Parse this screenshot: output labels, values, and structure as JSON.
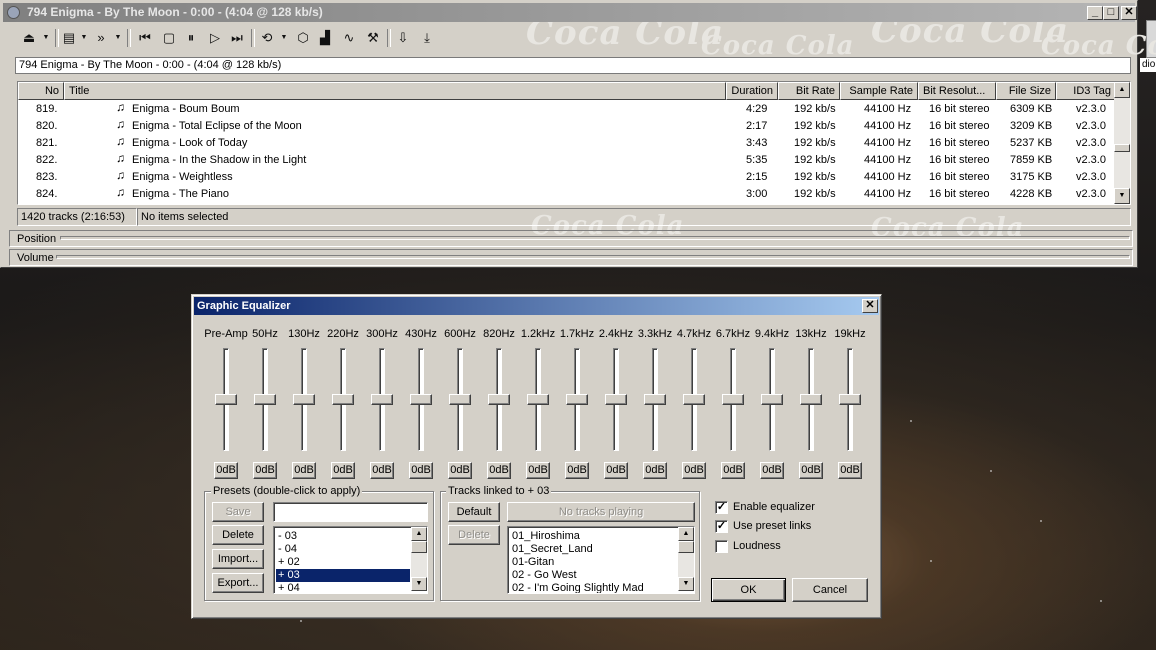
{
  "window": {
    "title": "794 Enigma - By The Moon - 0:00 - (4:04 @ 128 kb/s)",
    "address": "794 Enigma - By The Moon - 0:00 - (4:04 @ 128 kb/s)",
    "watermark": "Coca Cola",
    "caption_buttons": {
      "minimize": "_",
      "maximize": "□",
      "close": "✕"
    }
  },
  "toolbar": {
    "icons": [
      "eject-icon",
      "playlist-icon",
      "tools-icon",
      "previous-icon",
      "stop-icon",
      "play-icon",
      "next-icon",
      "repeat-icon",
      "cube-icon",
      "visualization-icon",
      "waveform-icon",
      "settings-icon",
      "arrow-down-icon",
      "download-icon"
    ]
  },
  "playlist": {
    "columns": [
      "No",
      "Title",
      "Duration",
      "Bit Rate",
      "Sample Rate",
      "Bit Resolut...",
      "File Size",
      "ID3 Tag"
    ],
    "rows": [
      {
        "no": "819.",
        "title": "Enigma - Boum Boum",
        "duration": "4:29",
        "bitrate": "192 kb/s",
        "samplerate": "44100 Hz",
        "resolution": "16 bit stereo",
        "size": "6309 KB",
        "tag": "v2.3.0"
      },
      {
        "no": "820.",
        "title": "Enigma - Total Eclipse of the Moon",
        "duration": "2:17",
        "bitrate": "192 kb/s",
        "samplerate": "44100 Hz",
        "resolution": "16 bit stereo",
        "size": "3209 KB",
        "tag": "v2.3.0"
      },
      {
        "no": "821.",
        "title": "Enigma - Look of Today",
        "duration": "3:43",
        "bitrate": "192 kb/s",
        "samplerate": "44100 Hz",
        "resolution": "16 bit stereo",
        "size": "5237 KB",
        "tag": "v2.3.0"
      },
      {
        "no": "822.",
        "title": "Enigma - In the Shadow in the Light",
        "duration": "5:35",
        "bitrate": "192 kb/s",
        "samplerate": "44100 Hz",
        "resolution": "16 bit stereo",
        "size": "7859 KB",
        "tag": "v2.3.0"
      },
      {
        "no": "823.",
        "title": "Enigma - Weightless",
        "duration": "2:15",
        "bitrate": "192 kb/s",
        "samplerate": "44100 Hz",
        "resolution": "16 bit stereo",
        "size": "3175 KB",
        "tag": "v2.3.0"
      },
      {
        "no": "824.",
        "title": "Enigma - The Piano",
        "duration": "3:00",
        "bitrate": "192 kb/s",
        "samplerate": "44100 Hz",
        "resolution": "16 bit stereo",
        "size": "4228 KB",
        "tag": "v2.3.0"
      }
    ]
  },
  "status": {
    "tracks": "1420 tracks (2:16:53)",
    "selection": "No items selected"
  },
  "position_label": "Position",
  "volume_label": "Volume",
  "equalizer": {
    "title": "Graphic Equalizer",
    "close": "✕",
    "bands": [
      {
        "label": "Pre-Amp",
        "value": "0dB"
      },
      {
        "label": "50Hz",
        "value": "0dB"
      },
      {
        "label": "130Hz",
        "value": "0dB"
      },
      {
        "label": "220Hz",
        "value": "0dB"
      },
      {
        "label": "300Hz",
        "value": "0dB"
      },
      {
        "label": "430Hz",
        "value": "0dB"
      },
      {
        "label": "600Hz",
        "value": "0dB"
      },
      {
        "label": "820Hz",
        "value": "0dB"
      },
      {
        "label": "1.2kHz",
        "value": "0dB"
      },
      {
        "label": "1.7kHz",
        "value": "0dB"
      },
      {
        "label": "2.4kHz",
        "value": "0dB"
      },
      {
        "label": "3.3kHz",
        "value": "0dB"
      },
      {
        "label": "4.7kHz",
        "value": "0dB"
      },
      {
        "label": "6.7kHz",
        "value": "0dB"
      },
      {
        "label": "9.4kHz",
        "value": "0dB"
      },
      {
        "label": "13kHz",
        "value": "0dB"
      },
      {
        "label": "19kHz",
        "value": "0dB"
      }
    ],
    "presets": {
      "group_label": "Presets (double-click to apply)",
      "save": "Save",
      "delete": "Delete",
      "import": "Import...",
      "export": "Export...",
      "name_value": "",
      "items": [
        "- 03",
        "- 04",
        "+ 02",
        "+ 03",
        "+ 04"
      ],
      "selected": "+ 03"
    },
    "tracks": {
      "group_label": "Tracks linked to + 03",
      "default": "Default",
      "no_tracks": "No tracks playing",
      "delete": "Delete",
      "items": [
        "01_Hiroshima",
        "01_Secret_Land",
        "01-Gitan",
        "02 - Go West",
        "02 - I'm Going Slightly Mad"
      ]
    },
    "options": {
      "enable_equalizer": "Enable equalizer",
      "enable_checked": true,
      "preset_links": "Use preset links",
      "preset_links_checked": true,
      "loudness": "Loudness",
      "loudness_checked": false
    },
    "ok": "OK",
    "cancel": "Cancel"
  },
  "desktop": {
    "edge_text": "dio"
  }
}
